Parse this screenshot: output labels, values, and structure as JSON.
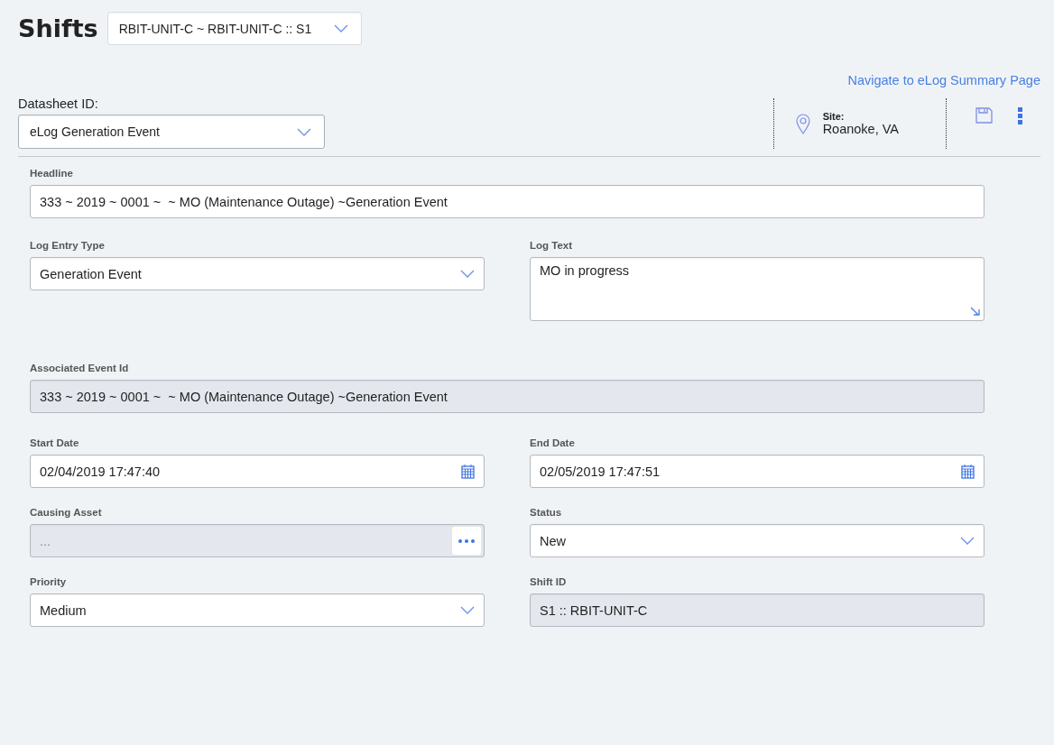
{
  "header": {
    "title": "Shifts",
    "shift_select": {
      "value": "RBIT-UNIT-C ~ RBIT-UNIT-C :: S1"
    }
  },
  "summary_link": "Navigate to eLog Summary Page",
  "datasheet": {
    "label": "Datasheet ID:",
    "value": "eLog Generation Event"
  },
  "site": {
    "label": "Site:",
    "value": "Roanoke, VA"
  },
  "form_rows": [
    [
      {
        "label": "Headline",
        "kind": "text",
        "value": "333 ~ 2019 ~ 0001 ~  ~ MO (Maintenance Outage) ~Generation Event",
        "disabled": false,
        "wide": true
      }
    ],
    [
      {
        "label": "Log Entry Type",
        "kind": "select",
        "value": "Generation Event",
        "disabled": false
      },
      {
        "label": "Log Text",
        "kind": "textarea",
        "value": "MO in progress",
        "disabled": false
      }
    ],
    [
      {
        "label": "Associated Event Id",
        "kind": "text",
        "value": "333 ~ 2019 ~ 0001 ~  ~ MO (Maintenance Outage) ~Generation Event",
        "disabled": true,
        "wide": true
      }
    ],
    [
      {
        "label": "Start Date",
        "kind": "date",
        "value": "02/04/2019 17:47:40",
        "disabled": false
      },
      {
        "label": "End Date",
        "kind": "date",
        "value": "02/05/2019 17:47:51",
        "disabled": false
      }
    ],
    [
      {
        "label": "Causing Asset",
        "kind": "lookup",
        "placeholder": "...",
        "disabled": true
      },
      {
        "label": "Status",
        "kind": "select",
        "value": "New",
        "disabled": false
      }
    ],
    [
      {
        "label": "Priority",
        "kind": "select",
        "value": "Medium",
        "disabled": false
      },
      {
        "label": "Shift ID",
        "kind": "text",
        "value": "S1 :: RBIT-UNIT-C",
        "disabled": true
      }
    ]
  ]
}
